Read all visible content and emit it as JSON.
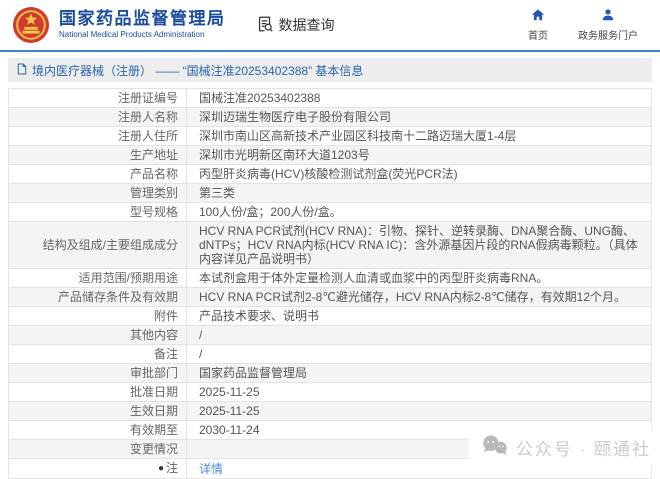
{
  "colors": {
    "brand_blue": "#1b4c9c",
    "accent_line_blue": "#4286c5",
    "breadcrumb_text_blue": "#2866ad",
    "link_blue": "#4a90d9",
    "row_alt_gray": "#f4f4f4",
    "emblem_red": "#d23b2e",
    "emblem_gold": "#f2c94c"
  },
  "header": {
    "org_name": "国家药品监督管理局",
    "org_name_en": "National Medical Products Administration",
    "nav_query": "数据查询",
    "nav_home": "首页",
    "nav_portal": "政务服务门户"
  },
  "breadcrumb": {
    "text": "境内医疗器械（注册） —— “国械注准20253402388” 基本信息"
  },
  "table": {
    "rows": [
      {
        "label": "注册证编号",
        "value": "国械注准20253402388"
      },
      {
        "label": "注册人名称",
        "value": "深圳迈瑞生物医疗电子股份有限公司"
      },
      {
        "label": "注册人住所",
        "value": "深圳市南山区高新技术产业园区科技南十二路迈瑞大厦1-4层"
      },
      {
        "label": "生产地址",
        "value": "深圳市光明新区南环大道1203号"
      },
      {
        "label": "产品名称",
        "value": "丙型肝炎病毒(HCV)核酸检测试剂盒(荧光PCR法)"
      },
      {
        "label": "管理类别",
        "value": "第三类"
      },
      {
        "label": "型号规格",
        "value": "100人份/盒；200人份/盒。"
      },
      {
        "label": "结构及组成/主要组成成分",
        "value": "HCV RNA PCR试剂(HCV RNA)：引物、探针、逆转录酶、DNA聚合酶、UNG酶、dNTPs；HCV RNA内标(HCV RNA IC)：含外源基因片段的RNA假病毒颗粒。（具体内容详见产品说明书）"
      },
      {
        "label": "适用范围/预期用途",
        "value": "本试剂盒用于体外定量检测人血清或血浆中的丙型肝炎病毒RNA。"
      },
      {
        "label": "产品储存条件及有效期",
        "value": "HCV RNA PCR试剂2-8℃避光储存，HCV RNA内标2-8℃储存，有效期12个月。"
      },
      {
        "label": "附件",
        "value": "产品技术要求、说明书"
      },
      {
        "label": "其他内容",
        "value": "/"
      },
      {
        "label": "备注",
        "value": "/"
      },
      {
        "label": "审批部门",
        "value": "国家药品监督管理局"
      },
      {
        "label": "批准日期",
        "value": "2025-11-25"
      },
      {
        "label": "生效日期",
        "value": "2025-11-25"
      },
      {
        "label": "有效期至",
        "value": "2030-11-24"
      },
      {
        "label": "变更情况",
        "value": ""
      },
      {
        "label": "注",
        "value": "详情",
        "link": true,
        "icon": "note-dot"
      }
    ]
  },
  "watermark": {
    "text": "公众号 · 颐通社"
  }
}
